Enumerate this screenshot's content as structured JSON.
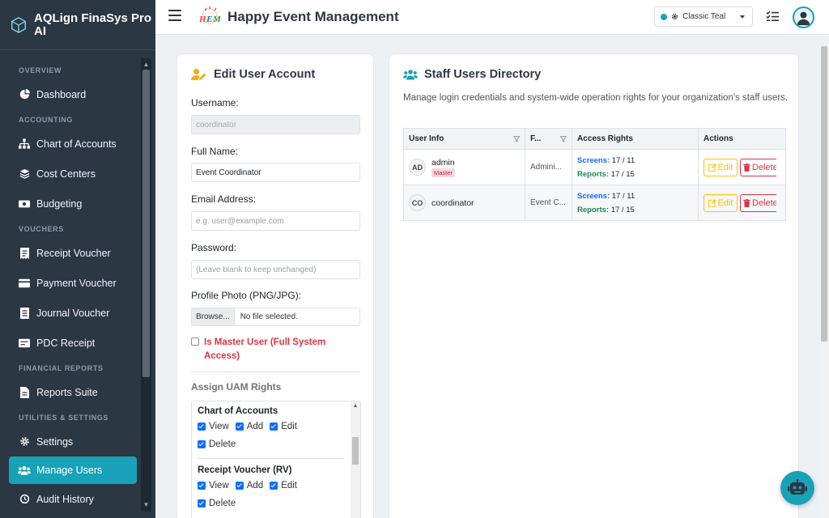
{
  "brand": {
    "name": "AQLign FinaSys Pro AI"
  },
  "sidebar": {
    "sections": [
      {
        "title": "OVERVIEW",
        "items": [
          {
            "label": "Dashboard",
            "icon": "dashboard-icon"
          }
        ]
      },
      {
        "title": "ACCOUNTING",
        "items": [
          {
            "label": "Chart of Accounts",
            "icon": "sitemap-icon"
          },
          {
            "label": "Cost Centers",
            "icon": "layers-icon"
          },
          {
            "label": "Budgeting",
            "icon": "money-icon"
          }
        ]
      },
      {
        "title": "VOUCHERS",
        "items": [
          {
            "label": "Receipt Voucher",
            "icon": "receipt-icon"
          },
          {
            "label": "Payment Voucher",
            "icon": "payment-icon"
          },
          {
            "label": "Journal Voucher",
            "icon": "journal-icon"
          },
          {
            "label": "PDC Receipt",
            "icon": "pdc-icon"
          }
        ]
      },
      {
        "title": "FINANCIAL REPORTS",
        "items": [
          {
            "label": "Reports Suite",
            "icon": "file-icon"
          }
        ]
      },
      {
        "title": "UTILITIES & SETTINGS",
        "items": [
          {
            "label": "Settings",
            "icon": "gear-icon"
          },
          {
            "label": "Manage Users",
            "icon": "users-icon",
            "active": true
          },
          {
            "label": "Audit History",
            "icon": "history-icon"
          }
        ]
      }
    ]
  },
  "topbar": {
    "title": "Happy Event Management",
    "theme": "Classic Teal"
  },
  "edit_form": {
    "title": "Edit User Account",
    "username_label": "Username:",
    "username_value": "coordinator",
    "fullname_label": "Full Name:",
    "fullname_value": "Event Coordinator",
    "email_label": "Email Address:",
    "email_placeholder": "e.g. user@example.com",
    "password_label": "Password:",
    "password_placeholder": "(Leave blank to keep unchanged)",
    "photo_label": "Profile Photo (PNG/JPG):",
    "browse_label": "Browse...",
    "file_status": "No file selected.",
    "master_label": "Is Master User (Full System Access)",
    "uam_title": "Assign UAM Rights",
    "uam_groups": [
      {
        "name": "Chart of Accounts",
        "opts": [
          "View",
          "Add",
          "Edit",
          "Delete"
        ]
      },
      {
        "name": "Receipt Voucher (RV)",
        "opts": [
          "View",
          "Add",
          "Edit",
          "Delete"
        ]
      }
    ]
  },
  "directory": {
    "title": "Staff Users Directory",
    "description": "Manage login credentials and system-wide operation rights for your organization's staff users.",
    "columns": [
      "User Info",
      "F...",
      "Access Rights",
      "Actions"
    ],
    "rows": [
      {
        "initials": "AD",
        "username": "admin",
        "badge": "Master",
        "fullname": "Admini...",
        "screens_label": "Screens:",
        "screens": "17 / 11",
        "reports_label": "Reports:",
        "reports": "17 / 15",
        "edit": "Edit",
        "delete": "Delete"
      },
      {
        "initials": "CO",
        "username": "coordinator",
        "badge": "",
        "fullname": "Event C...",
        "screens_label": "Screens:",
        "screens": "17 / 11",
        "reports_label": "Reports:",
        "reports": "17 / 15",
        "edit": "Edit",
        "delete": "Delete"
      }
    ]
  },
  "colors": {
    "accent": "#17a2b8",
    "sidebar": "#2c3744",
    "danger": "#dc3545",
    "warning": "#ffc107"
  }
}
